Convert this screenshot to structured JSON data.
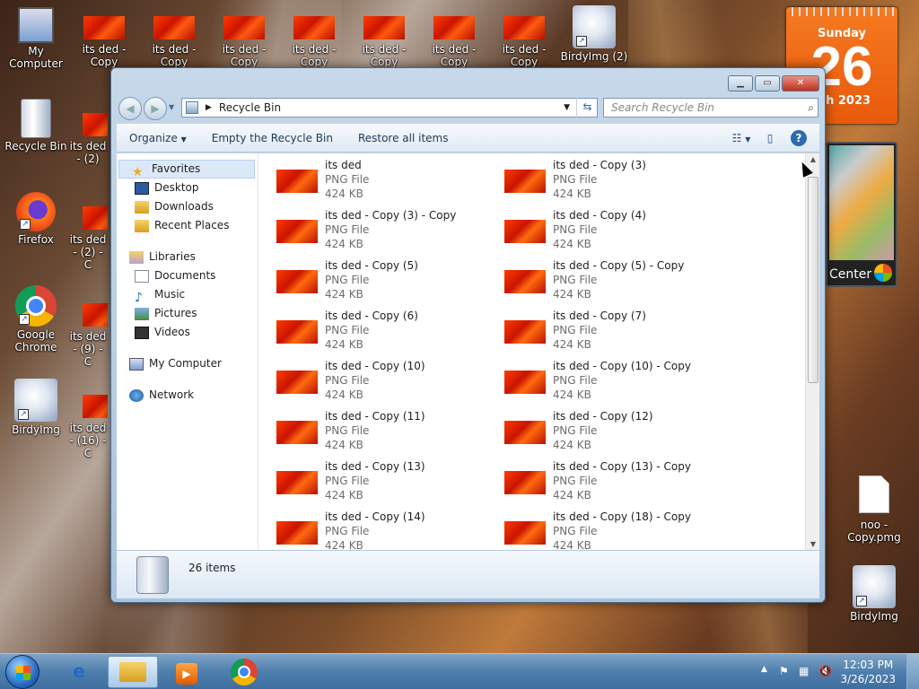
{
  "desktop": {
    "icons": [
      {
        "label": "My Computer",
        "kind": "computer"
      },
      {
        "label": "its ded - Copy",
        "kind": "png"
      },
      {
        "label": "its ded - Copy",
        "kind": "png"
      },
      {
        "label": "its ded - Copy",
        "kind": "png"
      },
      {
        "label": "its ded - Copy",
        "kind": "png"
      },
      {
        "label": "its ded - Copy",
        "kind": "png"
      },
      {
        "label": "its ded - Copy",
        "kind": "png"
      },
      {
        "label": "its ded - Copy",
        "kind": "png"
      },
      {
        "label": "BirdyImg (2)",
        "kind": "shortcut"
      },
      {
        "label": "Recycle Bin",
        "kind": "recycle"
      },
      {
        "label": "its ded - (2)",
        "kind": "png"
      },
      {
        "label": "Firefox",
        "kind": "shortcut"
      },
      {
        "label": "its ded - (2) - C",
        "kind": "png"
      },
      {
        "label": "Google Chrome",
        "kind": "shortcut"
      },
      {
        "label": "its ded - (9) - C",
        "kind": "png"
      },
      {
        "label": "BirdyImg",
        "kind": "shortcut"
      },
      {
        "label": "its ded - (16) - C",
        "kind": "png"
      },
      {
        "label": "noo - Copy.pmg",
        "kind": "file"
      },
      {
        "label": "BirdyImg",
        "kind": "shortcut"
      }
    ]
  },
  "gadgets": {
    "calendar": {
      "day_name": "Sunday",
      "day_number": "26",
      "month_year": "rch 2023"
    },
    "media_center_label": "Center"
  },
  "window": {
    "address": "Recycle Bin",
    "search_placeholder": "Search Recycle Bin",
    "toolbar": {
      "organize": "Organize",
      "empty": "Empty the Recycle Bin",
      "restore": "Restore all items"
    },
    "sidebar": {
      "favorites": "Favorites",
      "desktop": "Desktop",
      "downloads": "Downloads",
      "recent": "Recent Places",
      "libraries": "Libraries",
      "documents": "Documents",
      "music": "Music",
      "pictures": "Pictures",
      "videos": "Videos",
      "computer": "My Computer",
      "network": "Network"
    },
    "files": [
      {
        "name": "its ded",
        "type": "PNG File",
        "size": "424 KB"
      },
      {
        "name": "its ded - Copy (3)",
        "type": "PNG File",
        "size": "424 KB"
      },
      {
        "name": "its ded - Copy (3) - Copy",
        "type": "PNG File",
        "size": "424 KB"
      },
      {
        "name": "its ded - Copy (4)",
        "type": "PNG File",
        "size": "424 KB"
      },
      {
        "name": "its ded - Copy (5)",
        "type": "PNG File",
        "size": "424 KB"
      },
      {
        "name": "its ded - Copy (5) - Copy",
        "type": "PNG File",
        "size": "424 KB"
      },
      {
        "name": "its ded - Copy (6)",
        "type": "PNG File",
        "size": "424 KB"
      },
      {
        "name": "its ded - Copy (7)",
        "type": "PNG File",
        "size": "424 KB"
      },
      {
        "name": "its ded - Copy (10)",
        "type": "PNG File",
        "size": "424 KB"
      },
      {
        "name": "its ded - Copy (10) - Copy",
        "type": "PNG File",
        "size": "424 KB"
      },
      {
        "name": "its ded - Copy (11)",
        "type": "PNG File",
        "size": "424 KB"
      },
      {
        "name": "its ded - Copy (12)",
        "type": "PNG File",
        "size": "424 KB"
      },
      {
        "name": "its ded - Copy (13)",
        "type": "PNG File",
        "size": "424 KB"
      },
      {
        "name": "its ded - Copy (13) - Copy",
        "type": "PNG File",
        "size": "424 KB"
      },
      {
        "name": "its ded - Copy (14)",
        "type": "PNG File",
        "size": "424 KB"
      },
      {
        "name": "its ded - Copy (18) - Copy",
        "type": "PNG File",
        "size": "424 KB"
      }
    ],
    "item_count": "26 items"
  },
  "taskbar": {
    "time": "12:03 PM",
    "date": "3/26/2023"
  }
}
